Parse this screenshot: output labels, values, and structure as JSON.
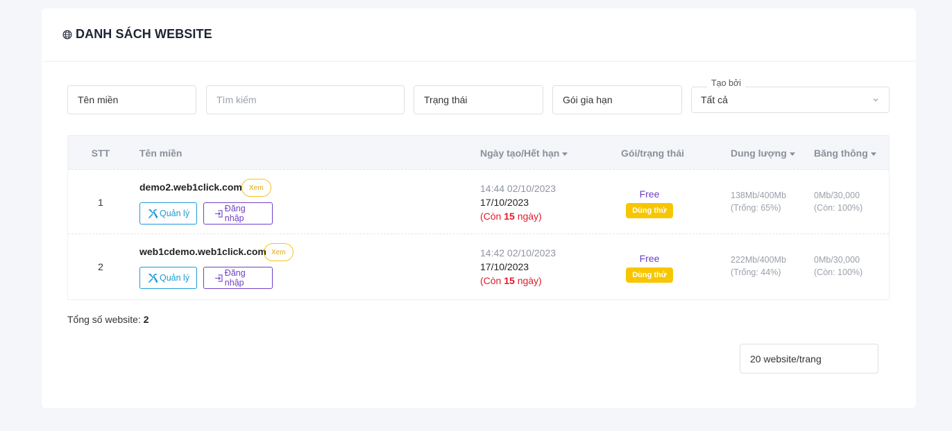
{
  "header": {
    "title": "DANH SÁCH WEBSITE",
    "icon": "globe-icon"
  },
  "filters": {
    "domain_placeholder": "Tên miền",
    "search_placeholder": "Tìm kiếm",
    "status_placeholder": "Trạng thái",
    "package_placeholder": "Gói gia hạn",
    "created_by_label": "Tạo bởi",
    "created_by_value": "Tất cả"
  },
  "table": {
    "columns": {
      "stt": "STT",
      "domain": "Tên miền",
      "dates": "Ngày tạo/Hết hạn",
      "package": "Gói/trạng thái",
      "storage": "Dung lượng",
      "bandwidth": "Băng thông"
    },
    "rows": [
      {
        "stt": "1",
        "domain": "demo2.web1click.com",
        "view_label": "Xem",
        "manage_label": "Quản lý",
        "login_label": "Đăng nhập",
        "created": "14:44 02/10/2023",
        "expires": "17/10/2023",
        "remaining_prefix": "(Còn ",
        "remaining_days": "15",
        "remaining_suffix": " ngày)",
        "package": "Free",
        "status": "Dùng thử",
        "storage_used": "138Mb/400Mb",
        "storage_free": "(Trống: 65%)",
        "bandwidth_used": "0Mb/30,000",
        "bandwidth_left": "(Còn: 100%)"
      },
      {
        "stt": "2",
        "domain": "web1cdemo.web1click.com",
        "view_label": "Xem",
        "manage_label": "Quản lý",
        "login_label": "Đăng nhập",
        "created": "14:42 02/10/2023",
        "expires": "17/10/2023",
        "remaining_prefix": "(Còn ",
        "remaining_days": "15",
        "remaining_suffix": " ngày)",
        "package": "Free",
        "status": "Dùng thử",
        "storage_used": "222Mb/400Mb",
        "storage_free": "(Trống: 44%)",
        "bandwidth_used": "0Mb/30,000",
        "bandwidth_left": "(Còn: 100%)"
      }
    ]
  },
  "footer": {
    "total_label": "Tổng số website: ",
    "total_value": "2",
    "page_size": "20 website/trang"
  },
  "colors": {
    "accent_blue": "#1a9ad6",
    "accent_purple": "#6f3fc7",
    "badge_yellow": "#f7c600",
    "danger_red": "#e0192b"
  }
}
